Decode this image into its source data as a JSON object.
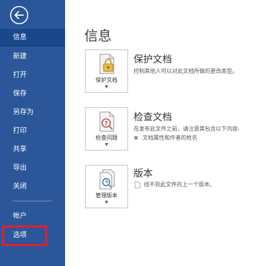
{
  "sidebar": {
    "back_icon": "back-arrow-icon",
    "items": [
      {
        "label": "信息"
      },
      {
        "label": "新建"
      },
      {
        "label": "打开"
      },
      {
        "label": "保存"
      },
      {
        "label": "另存为"
      },
      {
        "label": "打印"
      },
      {
        "label": "共享"
      },
      {
        "label": "导出"
      },
      {
        "label": "关闭"
      },
      {
        "label": "帐户"
      },
      {
        "label": "选项"
      }
    ],
    "active_index": 0,
    "background": "#2b579a",
    "highlight_color": "#e81c2c"
  },
  "main": {
    "title": "信息",
    "sections": [
      {
        "tile_label": "保护文档",
        "tile_icon": "lock-document-icon",
        "title": "保护文档",
        "description": "控制其他人可以对此文档所做的更改类型。"
      },
      {
        "tile_label": "检查问题",
        "tile_icon": "inspect-document-icon",
        "title": "检查文档",
        "description": "在发布此文件之前，请注意其包含以下内容:",
        "bullets": [
          "文档属性和作者的姓名"
        ]
      },
      {
        "tile_label": "管理版本",
        "tile_icon": "manage-versions-icon",
        "title": "版本",
        "note": "找不到此文件的上一个版本。"
      }
    ]
  }
}
